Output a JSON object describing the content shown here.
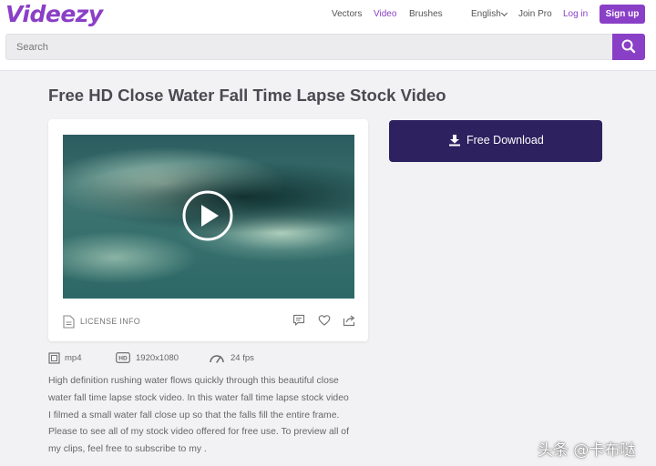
{
  "header": {
    "logo": "Videezy",
    "nav": [
      "Vectors",
      "Video",
      "Brushes"
    ],
    "active_nav": "Video",
    "language": "English",
    "join_pro": "Join Pro",
    "login": "Log in",
    "signup": "Sign up",
    "search_placeholder": "Search",
    "brand_color": "#8a3fc7"
  },
  "page": {
    "title": "Free HD Close Water Fall Time Lapse Stock Video",
    "license_label": "LICENSE INFO",
    "download_label": "Free Download",
    "download_color": "#2e2160",
    "meta": {
      "format": "mp4",
      "resolution": "1920x1080",
      "fps": "24 fps"
    },
    "description": [
      "High definition rushing water flows quickly through this beautiful close",
      "water fall time lapse stock video. In this water fall time lapse stock video",
      "I filmed a small water fall close up so that the falls fill the entire frame.",
      "Please to see all of my stock video offered for free use. To preview all of",
      "my clips, feel free to subscribe to my ."
    ]
  },
  "watermark": "头条 @卡布哒"
}
